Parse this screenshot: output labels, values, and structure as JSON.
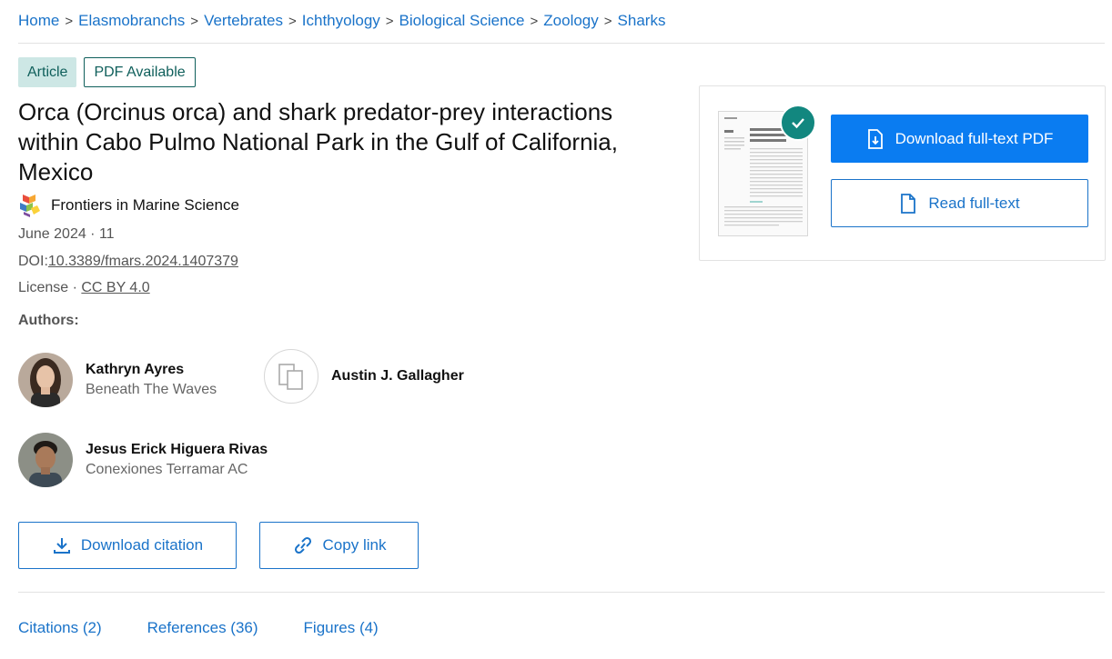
{
  "breadcrumb": [
    "Home",
    "Elasmobranchs",
    "Vertebrates",
    "Ichthyology",
    "Biological Science",
    "Zoology",
    "Sharks"
  ],
  "badges": {
    "type": "Article",
    "pdf": "PDF Available"
  },
  "title": "Orca (Orcinus orca) and shark predator-prey interactions within Cabo Pulmo National Park in the Gulf of California, Mexico",
  "journal": {
    "name": "Frontiers in Marine Science",
    "logo_icon": "frontiers-logo-icon"
  },
  "meta": {
    "date": "June 2024 · 11",
    "doi_label": "DOI:",
    "doi": "10.3389/fmars.2024.1407379",
    "license_label": "License · ",
    "license": "CC BY 4.0"
  },
  "authors_label": "Authors:",
  "authors": [
    {
      "name": "Kathryn Ayres",
      "affiliation": "Beneath The Waves"
    },
    {
      "name": "Austin J. Gallagher",
      "affiliation": ""
    },
    {
      "name": "Jesus Erick Higuera Rivas",
      "affiliation": "Conexiones Terramar AC"
    }
  ],
  "actions": {
    "download_citation": "Download citation",
    "copy_link": "Copy link"
  },
  "tabs": [
    "Citations (2)",
    "References (36)",
    "Figures (4)"
  ],
  "pdf_card": {
    "download_pdf": "Download full-text PDF",
    "read_fulltext": "Read full-text"
  },
  "colors": {
    "link": "#1a73c9",
    "primary": "#0a7cf1",
    "teal": "#12877f",
    "badge_bg": "#cde7e5"
  }
}
